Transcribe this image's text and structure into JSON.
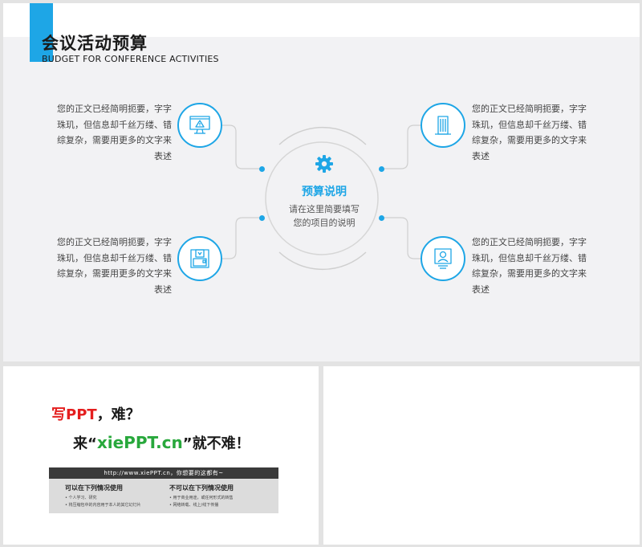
{
  "slide1": {
    "title_cn": "会议活动预算",
    "title_en": "BUDGET FOR CONFERENCE ACTIVITIES",
    "center": {
      "title": "预算说明",
      "desc_line1": "请在这里简要填写",
      "desc_line2": "您的项目的说明"
    },
    "items": [
      {
        "icon": "warning-monitor-icon",
        "text": "您的正文已经简明扼要，字字珠玑，但信息却千丝万缕、错综复杂，需要用更多的文字来表述"
      },
      {
        "icon": "building-icon",
        "text": "您的正文已经简明扼要，字字珠玑，但信息却千丝万缕、错综复杂，需要用更多的文字来表述"
      },
      {
        "icon": "document-folder-icon",
        "text": "您的正文已经简明扼要，字字珠玑，但信息却千丝万缕、错综复杂，需要用更多的文字来表述"
      },
      {
        "icon": "id-card-icon",
        "text": "您的正文已经简明扼要，字字珠玑，但信息却千丝万缕、错综复杂，需要用更多的文字来表述"
      }
    ],
    "colors": {
      "accent": "#1ea6e6"
    }
  },
  "slide2": {
    "line1_red": "写PPT",
    "line1_rest": "，难？",
    "line2_pre": "来“",
    "line2_brand": "xiePPT.cn",
    "line2_post": "”就不难！",
    "bar": "http://www.xiePPT.cn，你想要的这都有~",
    "left_heading": "可以在下列情况使用",
    "left_items": [
      "个人学习、研究",
      "将压缩包中的内容用于本人的其它幻灯片"
    ],
    "right_heading": "不可以在下列情况使用",
    "right_items": [
      "用于商业用途，或任何形式的转售",
      "网络转载、线上/线下传播"
    ],
    "colors": {
      "red": "#e41e1e",
      "green": "#28a83c"
    }
  }
}
